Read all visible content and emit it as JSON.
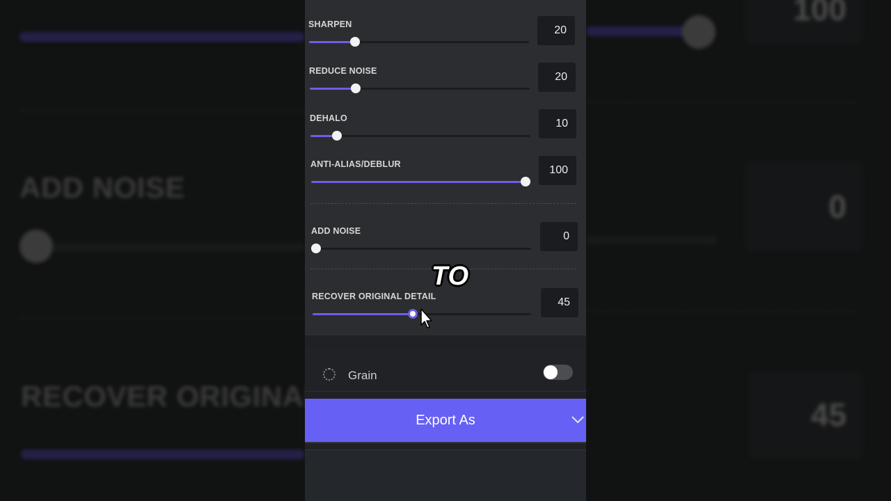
{
  "background": {
    "add_noise_label": "ADD NOISE",
    "add_noise_value": "0",
    "recover_label": "RECOVER ORIGINAL",
    "recover_value": "45",
    "top_value": "100"
  },
  "sliders": [
    {
      "label": "SHARPEN",
      "value": "20",
      "fraction": 0.21
    },
    {
      "label": "REDUCE NOISE",
      "value": "20",
      "fraction": 0.21
    },
    {
      "label": "DEHALO",
      "value": "10",
      "fraction": 0.12
    },
    {
      "label": "ANTI-ALIAS/DEBLUR",
      "value": "100",
      "fraction": 1.0
    },
    {
      "label": "ADD NOISE",
      "value": "0",
      "fraction": 0.0
    },
    {
      "label": "RECOVER ORIGINAL DETAIL",
      "value": "45",
      "fraction": 0.46
    }
  ],
  "overlay_caption": "TO",
  "grain": {
    "label": "Grain",
    "enabled": false
  },
  "export": {
    "label": "Export As"
  },
  "colors": {
    "accent": "#6760f5",
    "slider_fill": "#6b5fe8",
    "panel": "#2c2d30"
  },
  "icons": {
    "grain": "grain-icon",
    "export_chevron": "chevron-down-icon",
    "cursor": "mouse-cursor-icon"
  }
}
